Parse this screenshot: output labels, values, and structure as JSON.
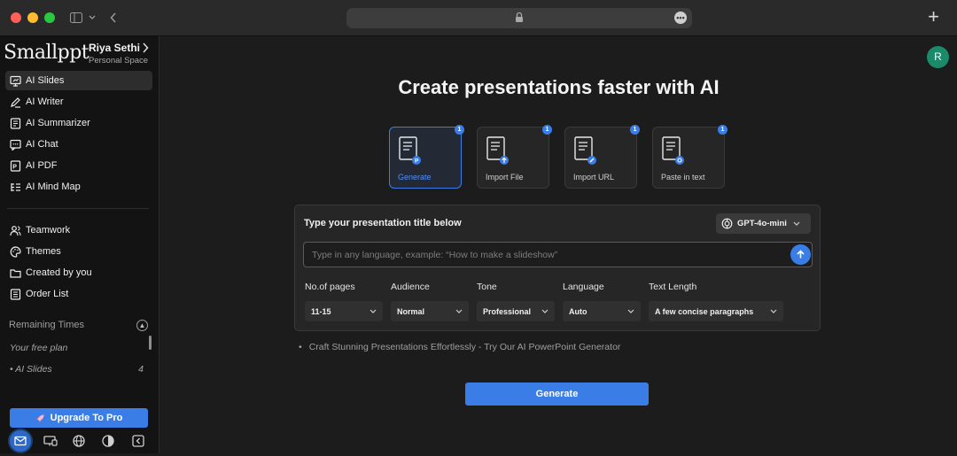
{
  "browser": {
    "url_more_icon": "ellipsis-icon",
    "new_tab_label": "+"
  },
  "sidebar": {
    "logo": "Smallppt",
    "user_name": "Riya Sethi",
    "user_space": "Personal Space",
    "nav_primary": [
      {
        "label": "AI Slides",
        "icon": "slides-icon",
        "active": true
      },
      {
        "label": "AI Writer",
        "icon": "pen-icon"
      },
      {
        "label": "AI Summarizer",
        "icon": "summary-icon"
      },
      {
        "label": "AI Chat",
        "icon": "chat-icon"
      },
      {
        "label": "AI PDF",
        "icon": "pdf-icon"
      },
      {
        "label": "AI Mind Map",
        "icon": "mindmap-icon"
      }
    ],
    "nav_secondary": [
      {
        "label": "Teamwork",
        "icon": "team-icon"
      },
      {
        "label": "Themes",
        "icon": "palette-icon"
      },
      {
        "label": "Created by you",
        "icon": "folder-icon"
      },
      {
        "label": "Order List",
        "icon": "list-icon"
      }
    ],
    "remaining_label": "Remaining Times",
    "free_plan_label": "Your free plan",
    "quota": {
      "label": "AI Slides",
      "count": "4"
    },
    "upgrade_label": "Upgrade To Pro",
    "bottom_icons": [
      "mail-icon",
      "monitor-icon",
      "globe-icon",
      "contrast-icon",
      "collapse-icon"
    ]
  },
  "header": {
    "avatar_letter": "R"
  },
  "main": {
    "title": "Create presentations faster with AI",
    "modes": [
      {
        "label": "Generate",
        "badge": "1",
        "active": true
      },
      {
        "label": "Import File",
        "badge": "1"
      },
      {
        "label": "Import URL",
        "badge": "1"
      },
      {
        "label": "Paste in text",
        "badge": "1"
      }
    ],
    "panel_title": "Type your presentation title below",
    "model": "GPT-4o-mini",
    "input_placeholder": "Type in any language, example: “How to make a slideshow”",
    "options": [
      {
        "label": "No.of pages",
        "value": "11-15"
      },
      {
        "label": "Audience",
        "value": "Normal"
      },
      {
        "label": "Tone",
        "value": "Professional"
      },
      {
        "label": "Language",
        "value": "Auto"
      },
      {
        "label": "Text Length",
        "value": "A few concise paragraphs"
      }
    ],
    "tip": "Craft Stunning Presentations Effortlessly - Try Our AI PowerPoint Generator",
    "generate_label": "Generate"
  },
  "colors": {
    "accent": "#3b7de6",
    "background": "#1c1c1c",
    "sidebar_bg": "#131313",
    "avatar": "#1a8a6a"
  }
}
